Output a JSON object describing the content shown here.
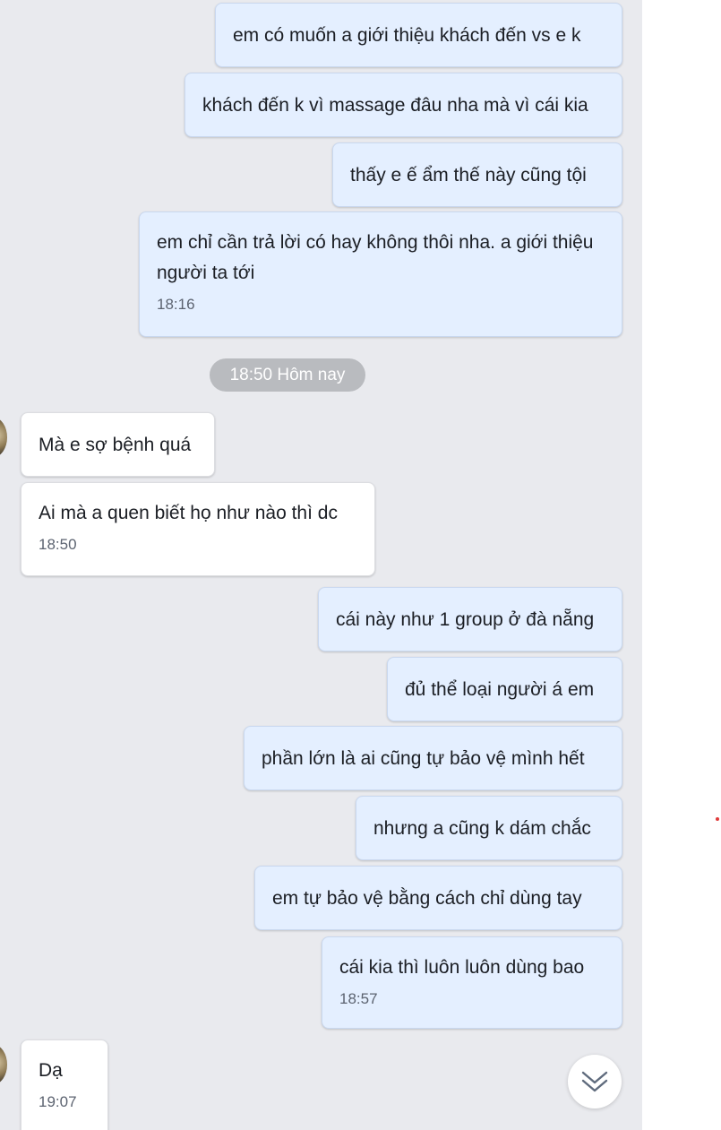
{
  "chat": {
    "messages": [
      {
        "dir": "out",
        "text": "em có muốn a giới thiệu khách đến vs e k"
      },
      {
        "dir": "out",
        "text": "khách đến k vì massage đâu nha mà vì cái kia"
      },
      {
        "dir": "out",
        "text": "thấy e ế ẩm thế này cũng tội"
      },
      {
        "dir": "out",
        "text": "em chỉ cần trả lời có hay không thôi nha. a giới thiệu người ta tới",
        "time": "18:16"
      },
      {
        "dir": "in",
        "text": "Mà e sợ bệnh quá"
      },
      {
        "dir": "in",
        "text": "Ai mà a quen biết họ như nào thì dc",
        "time": "18:50"
      },
      {
        "dir": "out",
        "text": "cái này như 1 group ở đà nẵng"
      },
      {
        "dir": "out",
        "text": "đủ thể loại người á em"
      },
      {
        "dir": "out",
        "text": "phần lớn là ai cũng tự bảo vệ mình hết"
      },
      {
        "dir": "out",
        "text": "nhưng a cũng k dám chắc"
      },
      {
        "dir": "out",
        "text": "em tự bảo vệ bằng cách chỉ dùng tay"
      },
      {
        "dir": "out",
        "text": "cái kia thì luôn luôn dùng bao",
        "time": "18:57"
      },
      {
        "dir": "in",
        "text": "Dạ",
        "time": "19:07"
      }
    ],
    "date_separator": "18:50 Hôm nay"
  },
  "icons": {
    "scroll_down": "chevron-double-down-icon",
    "avatar": "contact-avatar"
  },
  "colors": {
    "background": "#e9eaee",
    "outgoing_bubble": "#e4efff",
    "incoming_bubble": "#ffffff",
    "date_chip": "#b9bbbf"
  }
}
